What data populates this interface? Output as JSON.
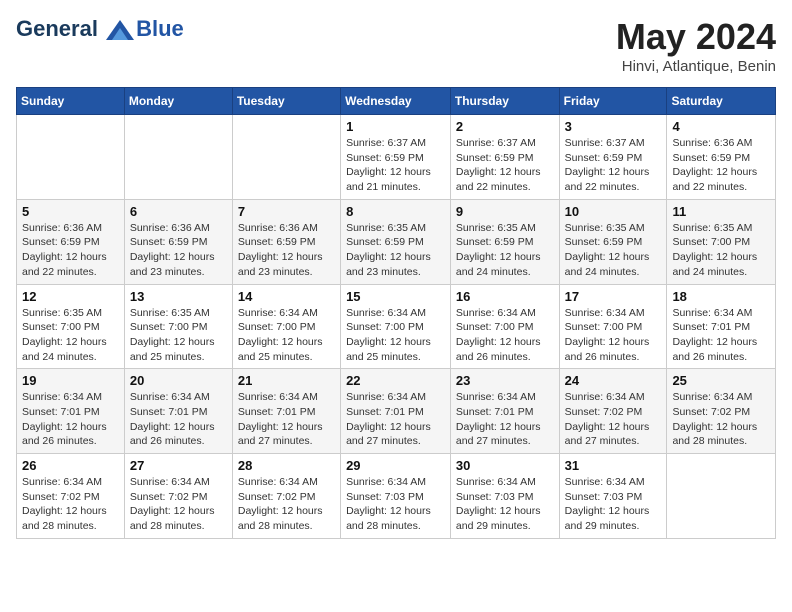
{
  "header": {
    "logo_line1": "General",
    "logo_line2": "Blue",
    "month": "May 2024",
    "location": "Hinvi, Atlantique, Benin"
  },
  "weekdays": [
    "Sunday",
    "Monday",
    "Tuesday",
    "Wednesday",
    "Thursday",
    "Friday",
    "Saturday"
  ],
  "weeks": [
    [
      {
        "day": "",
        "info": ""
      },
      {
        "day": "",
        "info": ""
      },
      {
        "day": "",
        "info": ""
      },
      {
        "day": "1",
        "info": "Sunrise: 6:37 AM\nSunset: 6:59 PM\nDaylight: 12 hours\nand 21 minutes."
      },
      {
        "day": "2",
        "info": "Sunrise: 6:37 AM\nSunset: 6:59 PM\nDaylight: 12 hours\nand 22 minutes."
      },
      {
        "day": "3",
        "info": "Sunrise: 6:37 AM\nSunset: 6:59 PM\nDaylight: 12 hours\nand 22 minutes."
      },
      {
        "day": "4",
        "info": "Sunrise: 6:36 AM\nSunset: 6:59 PM\nDaylight: 12 hours\nand 22 minutes."
      }
    ],
    [
      {
        "day": "5",
        "info": "Sunrise: 6:36 AM\nSunset: 6:59 PM\nDaylight: 12 hours\nand 22 minutes."
      },
      {
        "day": "6",
        "info": "Sunrise: 6:36 AM\nSunset: 6:59 PM\nDaylight: 12 hours\nand 23 minutes."
      },
      {
        "day": "7",
        "info": "Sunrise: 6:36 AM\nSunset: 6:59 PM\nDaylight: 12 hours\nand 23 minutes."
      },
      {
        "day": "8",
        "info": "Sunrise: 6:35 AM\nSunset: 6:59 PM\nDaylight: 12 hours\nand 23 minutes."
      },
      {
        "day": "9",
        "info": "Sunrise: 6:35 AM\nSunset: 6:59 PM\nDaylight: 12 hours\nand 24 minutes."
      },
      {
        "day": "10",
        "info": "Sunrise: 6:35 AM\nSunset: 6:59 PM\nDaylight: 12 hours\nand 24 minutes."
      },
      {
        "day": "11",
        "info": "Sunrise: 6:35 AM\nSunset: 7:00 PM\nDaylight: 12 hours\nand 24 minutes."
      }
    ],
    [
      {
        "day": "12",
        "info": "Sunrise: 6:35 AM\nSunset: 7:00 PM\nDaylight: 12 hours\nand 24 minutes."
      },
      {
        "day": "13",
        "info": "Sunrise: 6:35 AM\nSunset: 7:00 PM\nDaylight: 12 hours\nand 25 minutes."
      },
      {
        "day": "14",
        "info": "Sunrise: 6:34 AM\nSunset: 7:00 PM\nDaylight: 12 hours\nand 25 minutes."
      },
      {
        "day": "15",
        "info": "Sunrise: 6:34 AM\nSunset: 7:00 PM\nDaylight: 12 hours\nand 25 minutes."
      },
      {
        "day": "16",
        "info": "Sunrise: 6:34 AM\nSunset: 7:00 PM\nDaylight: 12 hours\nand 26 minutes."
      },
      {
        "day": "17",
        "info": "Sunrise: 6:34 AM\nSunset: 7:00 PM\nDaylight: 12 hours\nand 26 minutes."
      },
      {
        "day": "18",
        "info": "Sunrise: 6:34 AM\nSunset: 7:01 PM\nDaylight: 12 hours\nand 26 minutes."
      }
    ],
    [
      {
        "day": "19",
        "info": "Sunrise: 6:34 AM\nSunset: 7:01 PM\nDaylight: 12 hours\nand 26 minutes."
      },
      {
        "day": "20",
        "info": "Sunrise: 6:34 AM\nSunset: 7:01 PM\nDaylight: 12 hours\nand 26 minutes."
      },
      {
        "day": "21",
        "info": "Sunrise: 6:34 AM\nSunset: 7:01 PM\nDaylight: 12 hours\nand 27 minutes."
      },
      {
        "day": "22",
        "info": "Sunrise: 6:34 AM\nSunset: 7:01 PM\nDaylight: 12 hours\nand 27 minutes."
      },
      {
        "day": "23",
        "info": "Sunrise: 6:34 AM\nSunset: 7:01 PM\nDaylight: 12 hours\nand 27 minutes."
      },
      {
        "day": "24",
        "info": "Sunrise: 6:34 AM\nSunset: 7:02 PM\nDaylight: 12 hours\nand 27 minutes."
      },
      {
        "day": "25",
        "info": "Sunrise: 6:34 AM\nSunset: 7:02 PM\nDaylight: 12 hours\nand 28 minutes."
      }
    ],
    [
      {
        "day": "26",
        "info": "Sunrise: 6:34 AM\nSunset: 7:02 PM\nDaylight: 12 hours\nand 28 minutes."
      },
      {
        "day": "27",
        "info": "Sunrise: 6:34 AM\nSunset: 7:02 PM\nDaylight: 12 hours\nand 28 minutes."
      },
      {
        "day": "28",
        "info": "Sunrise: 6:34 AM\nSunset: 7:02 PM\nDaylight: 12 hours\nand 28 minutes."
      },
      {
        "day": "29",
        "info": "Sunrise: 6:34 AM\nSunset: 7:03 PM\nDaylight: 12 hours\nand 28 minutes."
      },
      {
        "day": "30",
        "info": "Sunrise: 6:34 AM\nSunset: 7:03 PM\nDaylight: 12 hours\nand 29 minutes."
      },
      {
        "day": "31",
        "info": "Sunrise: 6:34 AM\nSunset: 7:03 PM\nDaylight: 12 hours\nand 29 minutes."
      },
      {
        "day": "",
        "info": ""
      }
    ]
  ]
}
